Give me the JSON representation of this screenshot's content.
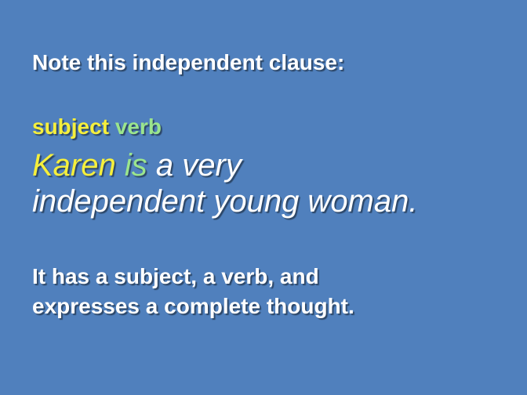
{
  "slide": {
    "heading": "Note this independent clause:",
    "labels": {
      "subject": "subject",
      "verb": "verb"
    },
    "sentence": {
      "subject": "Karen",
      "verb": "is",
      "rest_line1": "a very",
      "line2": "independent young woman."
    },
    "explanation": {
      "line1": "It has a subject, a verb, and",
      "line2": "expresses a complete thought."
    }
  },
  "colors": {
    "background": "#5080bd",
    "subject": "#f5ef3c",
    "verb": "#9be58d",
    "text": "#ffffff"
  }
}
